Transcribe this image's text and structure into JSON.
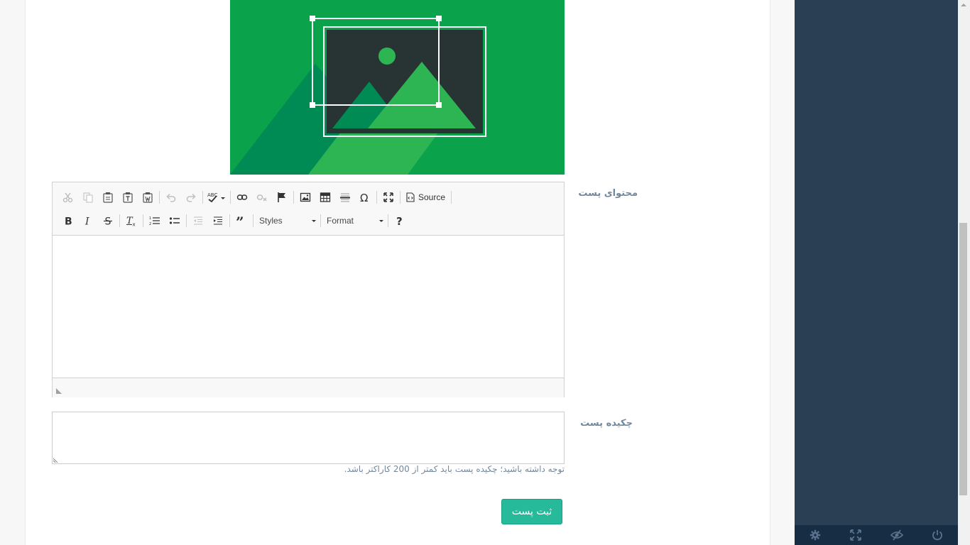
{
  "form": {
    "content_label": "محتوای پست",
    "excerpt_label": "چکیده پست",
    "excerpt_help": "توجه داشته باشید؛ چکیده پست باید کمتر از 200 کاراکتر باشد.",
    "submit_label": "ثبت پست"
  },
  "editor": {
    "source_label": "Source",
    "styles_label": "Styles",
    "format_label": "Format",
    "help_label": "?",
    "body_text": ""
  },
  "image": {
    "icon": "image-placeholder",
    "colors": {
      "background": "#2db553",
      "frame": "#283333",
      "mountain_dark": "#008b55",
      "mountain_light": "#2db553"
    }
  },
  "sidebar_footer": {
    "icons": [
      "gear-icon",
      "fullscreen-icon",
      "eye-slash-icon",
      "power-icon"
    ]
  },
  "colors": {
    "sidebar": "#2a3f54",
    "sidebar_footer": "#172d44",
    "submit": "#26b99a",
    "label": "#73879c"
  }
}
